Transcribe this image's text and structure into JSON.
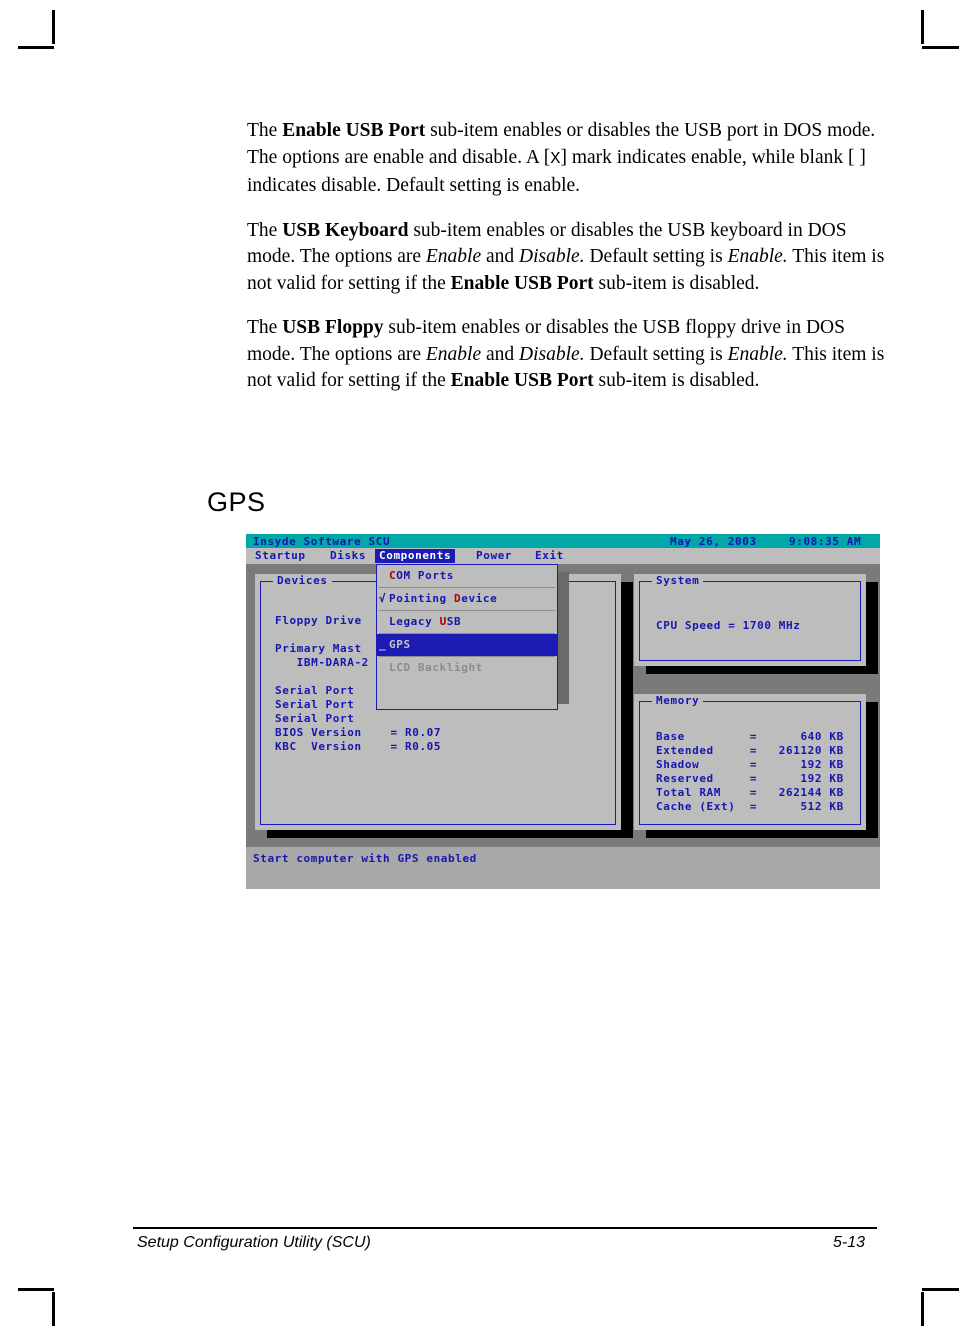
{
  "document": {
    "paragraphs": [
      {
        "id": "p-enable-usb-port",
        "runs": [
          {
            "t": "The ",
            "s": "normal"
          },
          {
            "t": "Enable USB Port",
            "s": "bold"
          },
          {
            "t": "  sub-item enables or disables the USB port in DOS mode. The options are enable and disable. A [",
            "s": "normal"
          },
          {
            "t": "X",
            "s": "mono"
          },
          {
            "t": "] mark indicates enable, while blank [  ] indicates disable. Default setting is enable.",
            "s": "normal"
          }
        ]
      },
      {
        "id": "p-usb-keyboard",
        "runs": [
          {
            "t": "The ",
            "s": "normal"
          },
          {
            "t": "USB Keyboard",
            "s": "bold"
          },
          {
            "t": "  sub-item enables or disables the USB keyboard in DOS mode. The options are ",
            "s": "normal"
          },
          {
            "t": "Enable",
            "s": "italic"
          },
          {
            "t": " and ",
            "s": "normal"
          },
          {
            "t": "Disable.",
            "s": "italic"
          },
          {
            "t": " Default setting is ",
            "s": "normal"
          },
          {
            "t": "Enable.",
            "s": "italic"
          },
          {
            "t": " This item is not valid for setting if the ",
            "s": "normal"
          },
          {
            "t": "Enable USB Port",
            "s": "bold"
          },
          {
            "t": " sub-item is disabled.",
            "s": "normal"
          }
        ]
      },
      {
        "id": "p-usb-floppy",
        "runs": [
          {
            "t": "The ",
            "s": "normal"
          },
          {
            "t": "USB Floppy",
            "s": "bold"
          },
          {
            "t": "  sub-item enables or disables the USB floppy drive in DOS mode. The options are ",
            "s": "normal"
          },
          {
            "t": "Enable",
            "s": "italic"
          },
          {
            "t": " and ",
            "s": "normal"
          },
          {
            "t": "Disable.",
            "s": "italic"
          },
          {
            "t": " Default setting is ",
            "s": "normal"
          },
          {
            "t": "Enable.",
            "s": "italic"
          },
          {
            "t": " This item is not valid for setting if the ",
            "s": "normal"
          },
          {
            "t": "Enable USB Port",
            "s": "bold"
          },
          {
            "t": " sub-item is disabled.",
            "s": "normal"
          }
        ]
      }
    ],
    "heading": "GPS",
    "footer": {
      "left": "Setup Configuration Utility (SCU)",
      "right": "5-13"
    }
  },
  "bios": {
    "titlebar": {
      "app": "Insyde Software SCU",
      "date": "May 26, 2003",
      "time": "9:08:35 AM"
    },
    "menubar": {
      "items": [
        {
          "label": "Startup",
          "active": false
        },
        {
          "label": "Disks",
          "active": false
        },
        {
          "label": "Components",
          "active": true
        },
        {
          "label": "Power",
          "active": false
        },
        {
          "label": "Exit",
          "active": false
        }
      ]
    },
    "dropdown": {
      "owner": "Components",
      "items": [
        {
          "label": "COM Ports",
          "accel": "C",
          "mark": "",
          "state": "normal"
        },
        {
          "label": "Pointing Device",
          "accel": "D",
          "mark": "√",
          "state": "normal"
        },
        {
          "label": "Legacy USB",
          "accel": "U",
          "mark": "",
          "state": "normal"
        },
        {
          "label": "GPS",
          "accel": "G",
          "mark": "_",
          "state": "selected"
        },
        {
          "label": "LCD Backlight",
          "accel": "L",
          "mark": "",
          "state": "disabled"
        }
      ]
    },
    "panels": {
      "devices": {
        "legend": "Devices",
        "rows": [
          "Floppy Drive",
          "Primary Mast",
          "   IBM-DARA-2",
          "Serial Port",
          "Serial Port",
          "Serial Port",
          "BIOS Version    = R0.07",
          "KBC  Version    = R0.05"
        ]
      },
      "system": {
        "legend": "System",
        "rows": [
          "CPU Speed = 1700 MHz"
        ]
      },
      "memory": {
        "legend": "Memory",
        "rows": [
          "Base         =      640 KB",
          "Extended     =   261120 KB",
          "Shadow       =      192 KB",
          "Reserved     =      192 KB",
          "Total RAM    =   262144 KB",
          "Cache (Ext)  =      512 KB"
        ]
      }
    },
    "statusline": "Start computer with GPS enabled",
    "colors": {
      "titlebar_bg": "#00a8a8",
      "panel_bg": "#bdbdbd",
      "desktop_bg": "#7a7a7a",
      "text_blue": "#1616b0",
      "accel_red": "#b00000",
      "highlight_bg": "#1c1cb4",
      "highlight_fg": "#c8c8c8",
      "disabled_fg": "#8c8c8c",
      "status_bg": "#a8a8a8",
      "shadow": "#000000"
    }
  }
}
